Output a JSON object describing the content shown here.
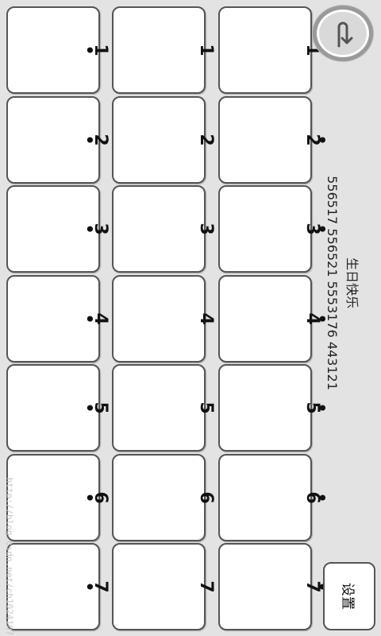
{
  "song": {
    "title": "生日快乐",
    "notes": "556517 556521 5553176 443121"
  },
  "settings_button": {
    "label": "设置"
  },
  "back_button": {
    "icon": "back-arrow-icon"
  },
  "watermark": "http://blog.csdn.net/ch1024107",
  "key_rows": [
    {
      "row": "high",
      "keys": [
        {
          "note": "1",
          "dot": "top"
        },
        {
          "note": "2",
          "dot": "top"
        },
        {
          "note": "3",
          "dot": "top"
        },
        {
          "note": "4",
          "dot": "top"
        },
        {
          "note": "5",
          "dot": "top"
        },
        {
          "note": "6",
          "dot": "top"
        },
        {
          "note": "7",
          "dot": "top"
        }
      ]
    },
    {
      "row": "middle",
      "keys": [
        {
          "note": "1",
          "dot": "none"
        },
        {
          "note": "2",
          "dot": "none"
        },
        {
          "note": "3",
          "dot": "none"
        },
        {
          "note": "4",
          "dot": "none"
        },
        {
          "note": "5",
          "dot": "none"
        },
        {
          "note": "6",
          "dot": "none"
        },
        {
          "note": "7",
          "dot": "none"
        }
      ]
    },
    {
      "row": "low",
      "keys": [
        {
          "note": "1",
          "dot": "bottom"
        },
        {
          "note": "2",
          "dot": "bottom"
        },
        {
          "note": "3",
          "dot": "bottom"
        },
        {
          "note": "4",
          "dot": "bottom"
        },
        {
          "note": "5",
          "dot": "bottom"
        },
        {
          "note": "6",
          "dot": "bottom"
        },
        {
          "note": "7",
          "dot": "bottom"
        }
      ]
    }
  ],
  "colors": {
    "background": "#e3e3e3",
    "key_face": "#ffffff",
    "key_border": "#555555"
  }
}
